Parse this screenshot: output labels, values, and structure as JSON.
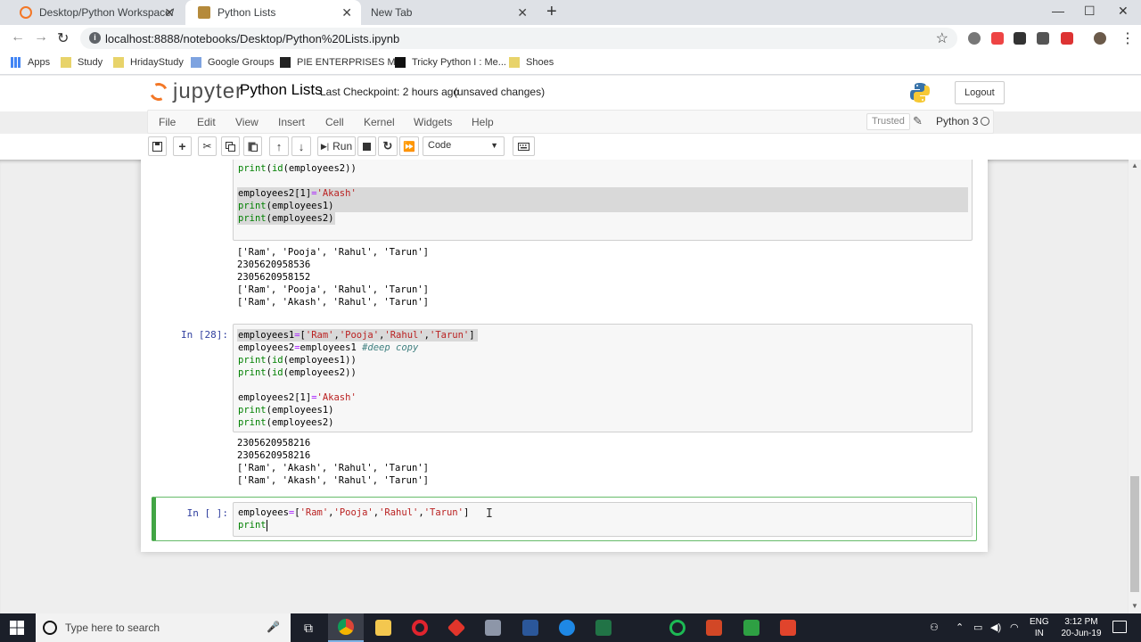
{
  "browser": {
    "tabs": [
      {
        "label": "Desktop/Python Workspace/",
        "icon": "jupyter-favicon"
      },
      {
        "label": "Python Lists",
        "icon": "notebook-favicon"
      },
      {
        "label": "New Tab",
        "icon": ""
      }
    ],
    "url": "localhost:8888/notebooks/Desktop/Python%20Lists.ipynb",
    "bookmarks": [
      "Apps",
      "Study",
      "HridayStudy",
      "Google Groups",
      "PIE ENTERPRISES M...",
      "Tricky Python I : Me...",
      "Shoes"
    ]
  },
  "jupyter": {
    "logo_text": "jupyter",
    "notebook_title": "Python Lists",
    "checkpoint": "Last Checkpoint: 2 hours ago",
    "autosave": "(unsaved changes)",
    "logout": "Logout",
    "menu": [
      "File",
      "Edit",
      "View",
      "Insert",
      "Cell",
      "Kernel",
      "Widgets",
      "Help"
    ],
    "trusted": "Trusted",
    "kernel": "Python 3",
    "toolbar": {
      "run_label": "Run",
      "cell_type": "Code"
    }
  },
  "cells": {
    "cell1": {
      "partial_line": "print(id(employees2))",
      "lines": [
        "employees2[1]='Akash'",
        "print(employees1)",
        "print(employees2)"
      ],
      "output": [
        "['Ram', 'Pooja', 'Rahul', 'Tarun']",
        "2305620958536",
        "2305620958152",
        "['Ram', 'Pooja', 'Rahul', 'Tarun']",
        "['Ram', 'Akash', 'Rahul', 'Tarun']"
      ]
    },
    "cell2": {
      "prompt": "In [28]:",
      "output": [
        "2305620958216",
        "2305620958216",
        "['Ram', 'Akash', 'Rahul', 'Tarun']",
        "['Ram', 'Akash', 'Rahul', 'Tarun']"
      ]
    },
    "cell3": {
      "prompt": "In [ ]:"
    }
  },
  "taskbar": {
    "search_placeholder": "Type here to search",
    "lang_top": "ENG",
    "lang_bottom": "IN",
    "time": "3:12 PM",
    "date": "20-Jun-19"
  }
}
